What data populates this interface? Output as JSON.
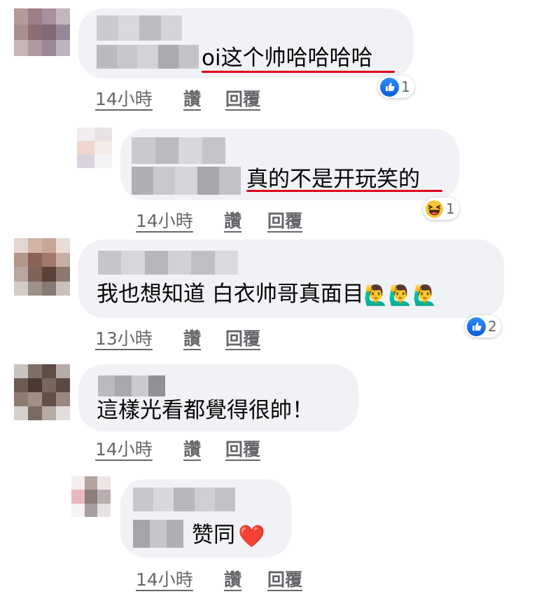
{
  "comments": [
    {
      "text_suffix": "oi这个帅哈哈哈哈",
      "time": "14小時",
      "like_label": "讚",
      "reply_label": "回覆",
      "reaction": {
        "icon": "like-icon",
        "count": "1"
      }
    },
    {
      "text_suffix": "真的不是开玩笑的",
      "time": "14小時",
      "like_label": "讚",
      "reply_label": "回覆",
      "reaction": {
        "icon": "haha-icon",
        "count": "1"
      }
    },
    {
      "text": "我也想知道 白衣帅哥真面目",
      "emoji": "🙋‍♂️🙋‍♂️🙋‍♂️",
      "time": "13小時",
      "like_label": "讚",
      "reply_label": "回覆",
      "reaction": {
        "icon": "like-icon",
        "count": "2"
      }
    },
    {
      "text": "這樣光看都覺得很帥！",
      "time": "14小時",
      "like_label": "讚",
      "reply_label": "回覆"
    },
    {
      "text": "赞同",
      "emoji": "❤️",
      "time": "14小時",
      "like_label": "讚",
      "reply_label": "回覆"
    }
  ],
  "colors": {
    "bubble": "#f0f2f5",
    "meta_text": "#65676b",
    "underline": "#e0001a",
    "like_blue": "#1877f2"
  }
}
